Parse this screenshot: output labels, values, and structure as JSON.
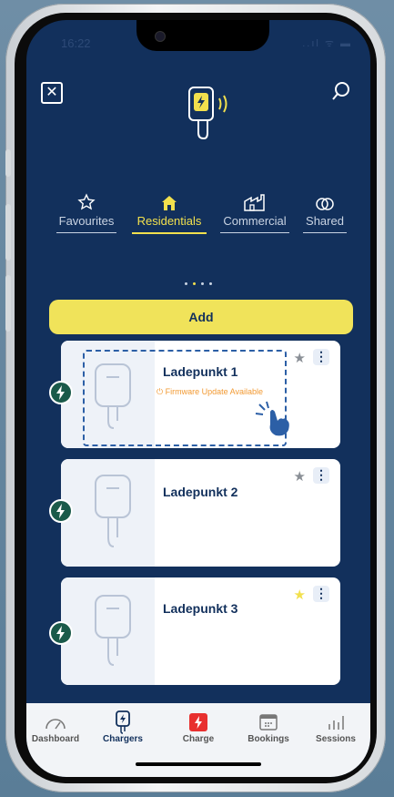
{
  "status": {
    "time": "16:22",
    "icons": "..ıl ᯤ ▬"
  },
  "header": {
    "close_icon": "close-icon",
    "search_icon": "search-icon",
    "logo_icon": "charger-logo-icon"
  },
  "tabs": [
    {
      "label": "Favourites",
      "icon": "star-icon",
      "active": false
    },
    {
      "label": "Residentials",
      "icon": "home-icon",
      "active": true
    },
    {
      "label": "Commercial",
      "icon": "factory-icon",
      "active": false
    },
    {
      "label": "Shared",
      "icon": "link-icon",
      "active": false
    }
  ],
  "pager": {
    "pages": 4,
    "current": 2
  },
  "add_button": {
    "label": "Add"
  },
  "chargers": [
    {
      "name": "Ladepunkt 1",
      "status": "Firmware Update Available",
      "favorite": false
    },
    {
      "name": "Ladepunkt 2",
      "status": "",
      "favorite": false
    },
    {
      "name": "Ladepunkt 3",
      "status": "",
      "favorite": true
    }
  ],
  "bottom_nav": [
    {
      "label": "Dashboard",
      "icon": "gauge-icon",
      "active": false
    },
    {
      "label": "Chargers",
      "icon": "charger-icon",
      "active": true
    },
    {
      "label": "Charge",
      "icon": "bolt-icon",
      "active": false
    },
    {
      "label": "Bookings",
      "icon": "calendar-icon",
      "active": false
    },
    {
      "label": "Sessions",
      "icon": "bar-chart-icon",
      "active": false
    }
  ],
  "colors": {
    "navy": "#12305c",
    "accent": "#f2e04d",
    "warning": "#f29a33",
    "charge_red": "#e8302f",
    "badge_green": "#1a5a4a"
  }
}
